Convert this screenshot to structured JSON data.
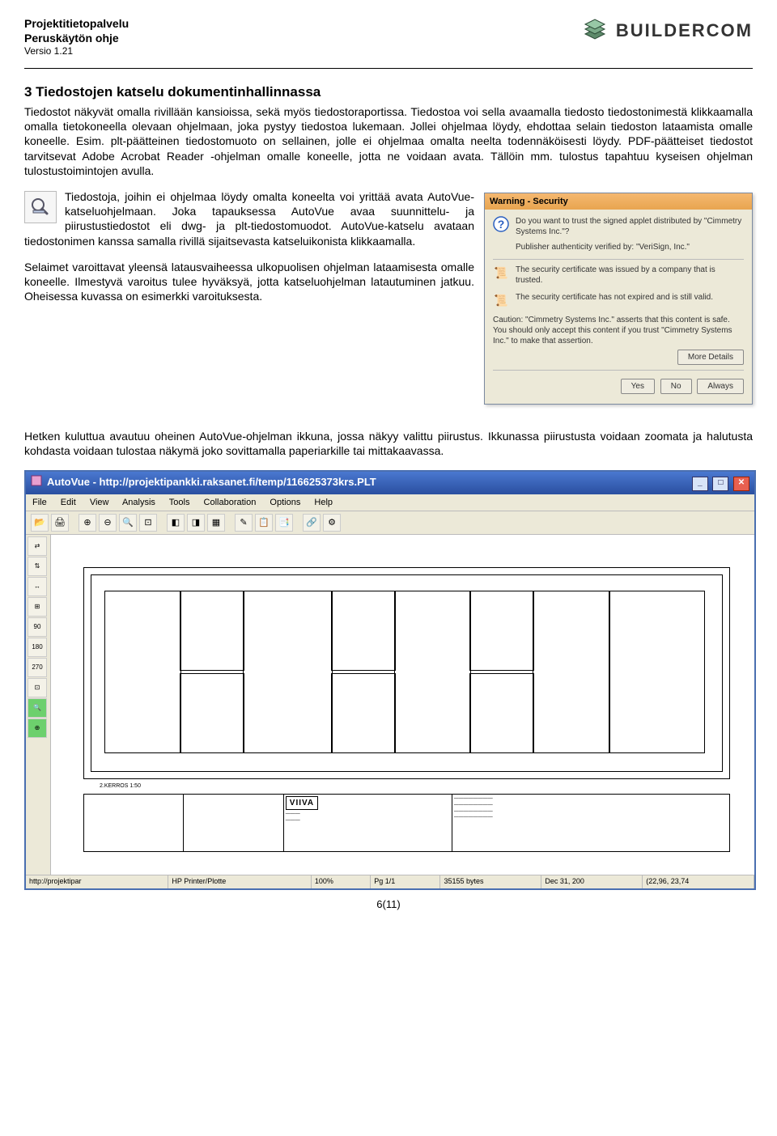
{
  "header": {
    "title": "Projektitietopalvelu",
    "subtitle": "Peruskäytön ohje",
    "version": "Versio 1.21",
    "logo_text": "BUILDERCOM"
  },
  "section": {
    "heading": "3 Tiedostojen katselu dokumentinhallinnassa",
    "p1": "Tiedostot näkyvät omalla rivillään kansioissa, sekä myös tiedostoraportissa. Tiedostoa voi sella avaamalla tiedosto tiedostonimestä klikkaamalla omalla tietokoneella olevaan ohjelmaan, joka pystyy tiedostoa lukemaan. Jollei ohjelmaa löydy, ehdottaa selain tiedoston lataamista omalle koneelle. Esim. plt-päätteinen tiedostomuoto on sellainen, jolle ei ohjelmaa omalta neelta todennäköisesti löydy. PDF-päätteiset tiedostot tarvitsevat Adobe Acrobat Reader -ohjelman omalle koneelle, jotta ne voidaan avata. Tällöin mm. tulostus tapahtuu kyseisen ohjelman tulostustoimintojen avulla.",
    "p2": "Tiedostoja, joihin ei ohjelmaa löydy omalta koneelta voi yrittää avata AutoVue-katseluohjelmaan. Joka tapauksessa AutoVue avaa suunnittelu- ja piirustustiedostot eli dwg- ja plt-tiedostomuodot. AutoVue-katselu avataan tiedostonimen kanssa samalla rivillä sijaitsevasta katseluikonista klikkaamalla.",
    "p3": "Selaimet varoittavat yleensä latausvaiheessa ulkopuolisen ohjelman lataamisesta omalle koneelle. Ilmestyvä varoitus tulee hyväksyä, jotta katseluohjelman latautuminen jatkuu. Oheisessa kuvassa on esimerkki varoituksesta.",
    "p4": "Hetken kuluttua avautuu oheinen AutoVue-ohjelman ikkuna, jossa näkyy valittu piirustus. Ikkunassa piirustusta voidaan zoomata ja halutusta kohdasta voidaan tulostaa näkymä joko sovittamalla paperiarkille tai mittakaavassa."
  },
  "security_dialog": {
    "title": "Warning - Security",
    "q": "Do you want to trust the signed applet distributed by \"Cimmetry Systems Inc.\"?",
    "auth": "Publisher authenticity verified by: \"VeriSign, Inc.\"",
    "cert1": "The security certificate was issued by a company that is trusted.",
    "cert2": "The security certificate has not expired and is still valid.",
    "caution": "Caution: \"Cimmetry Systems Inc.\" asserts that this content is safe. You should only accept this content if you trust \"Cimmetry Systems Inc.\" to make that assertion.",
    "more": "More Details",
    "yes": "Yes",
    "no": "No",
    "always": "Always"
  },
  "autovue": {
    "title": "AutoVue - http://projektipankki.raksanet.fi/temp/116625373krs.PLT",
    "menu": [
      "File",
      "Edit",
      "View",
      "Analysis",
      "Tools",
      "Collaboration",
      "Options",
      "Help"
    ],
    "side": [
      "⇄",
      "⇅",
      "↔",
      "⊞",
      "90",
      "180",
      "270",
      "⊡",
      "🔍",
      "⊕"
    ],
    "drawing_label": "2.KERROS 1:50",
    "titleblock_brand": "VIIVA",
    "status": {
      "url": "http://projektipar",
      "printer": "HP Printer/Plotte",
      "zoom": "100%",
      "page": "Pg 1/1",
      "bytes": "35155 bytes",
      "date": "Dec 31, 200",
      "coords": "(22,96, 23,74"
    }
  },
  "page_number": "6(11)"
}
